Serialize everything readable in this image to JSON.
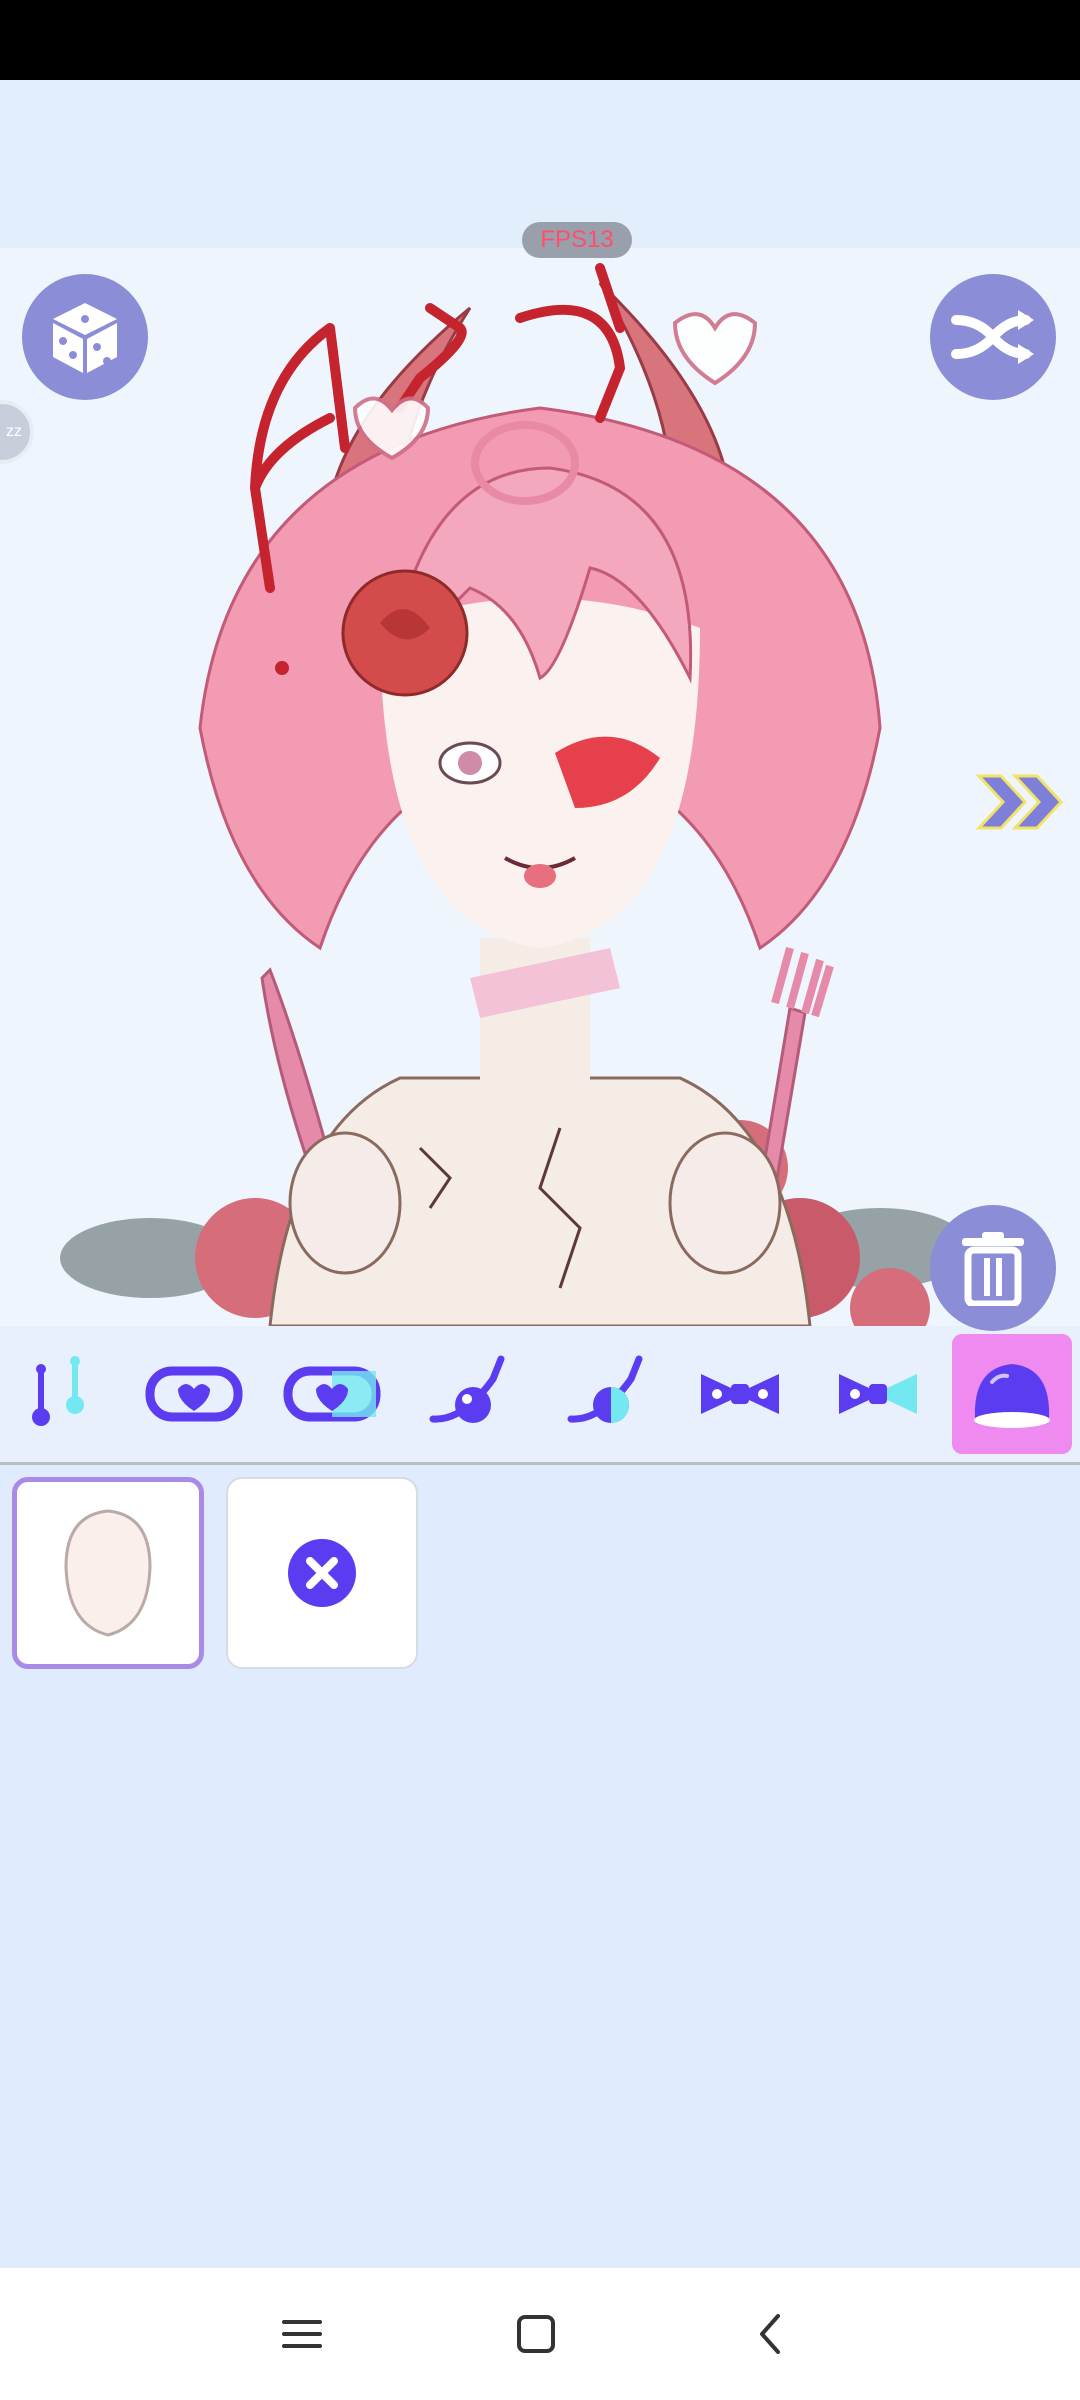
{
  "status": {
    "fps_label": "FPS13"
  },
  "side_handle": {
    "label": "zz"
  },
  "colors": {
    "accent": "#8b8ed6",
    "tool_purple": "#5b3cf0",
    "tool_cyan": "#74e8f0",
    "active_tab": "#ee8af0",
    "selected_border": "#a98ae6"
  },
  "canvas": {
    "buttons": [
      {
        "name": "dice-icon",
        "role": "randomize"
      },
      {
        "name": "shuffle-icon",
        "role": "shuffle"
      },
      {
        "name": "trash-icon",
        "role": "delete"
      },
      {
        "name": "double-chevron-right-icon",
        "role": "next"
      }
    ]
  },
  "toolbar": {
    "tabs": [
      {
        "icon": "earrings-icon"
      },
      {
        "icon": "heart-choker-icon"
      },
      {
        "icon": "heart-choker-alt-icon"
      },
      {
        "icon": "pendant-icon"
      },
      {
        "icon": "pendant-alt-icon"
      },
      {
        "icon": "bow-icon"
      },
      {
        "icon": "bow-alt-icon"
      },
      {
        "icon": "blob-icon",
        "active": true
      }
    ]
  },
  "options": [
    {
      "icon": "face-base-icon",
      "selected": true
    },
    {
      "icon": "remove-x-icon",
      "selected": false
    }
  ],
  "nav": {
    "buttons": [
      "menu-icon",
      "home-icon",
      "back-icon"
    ]
  }
}
